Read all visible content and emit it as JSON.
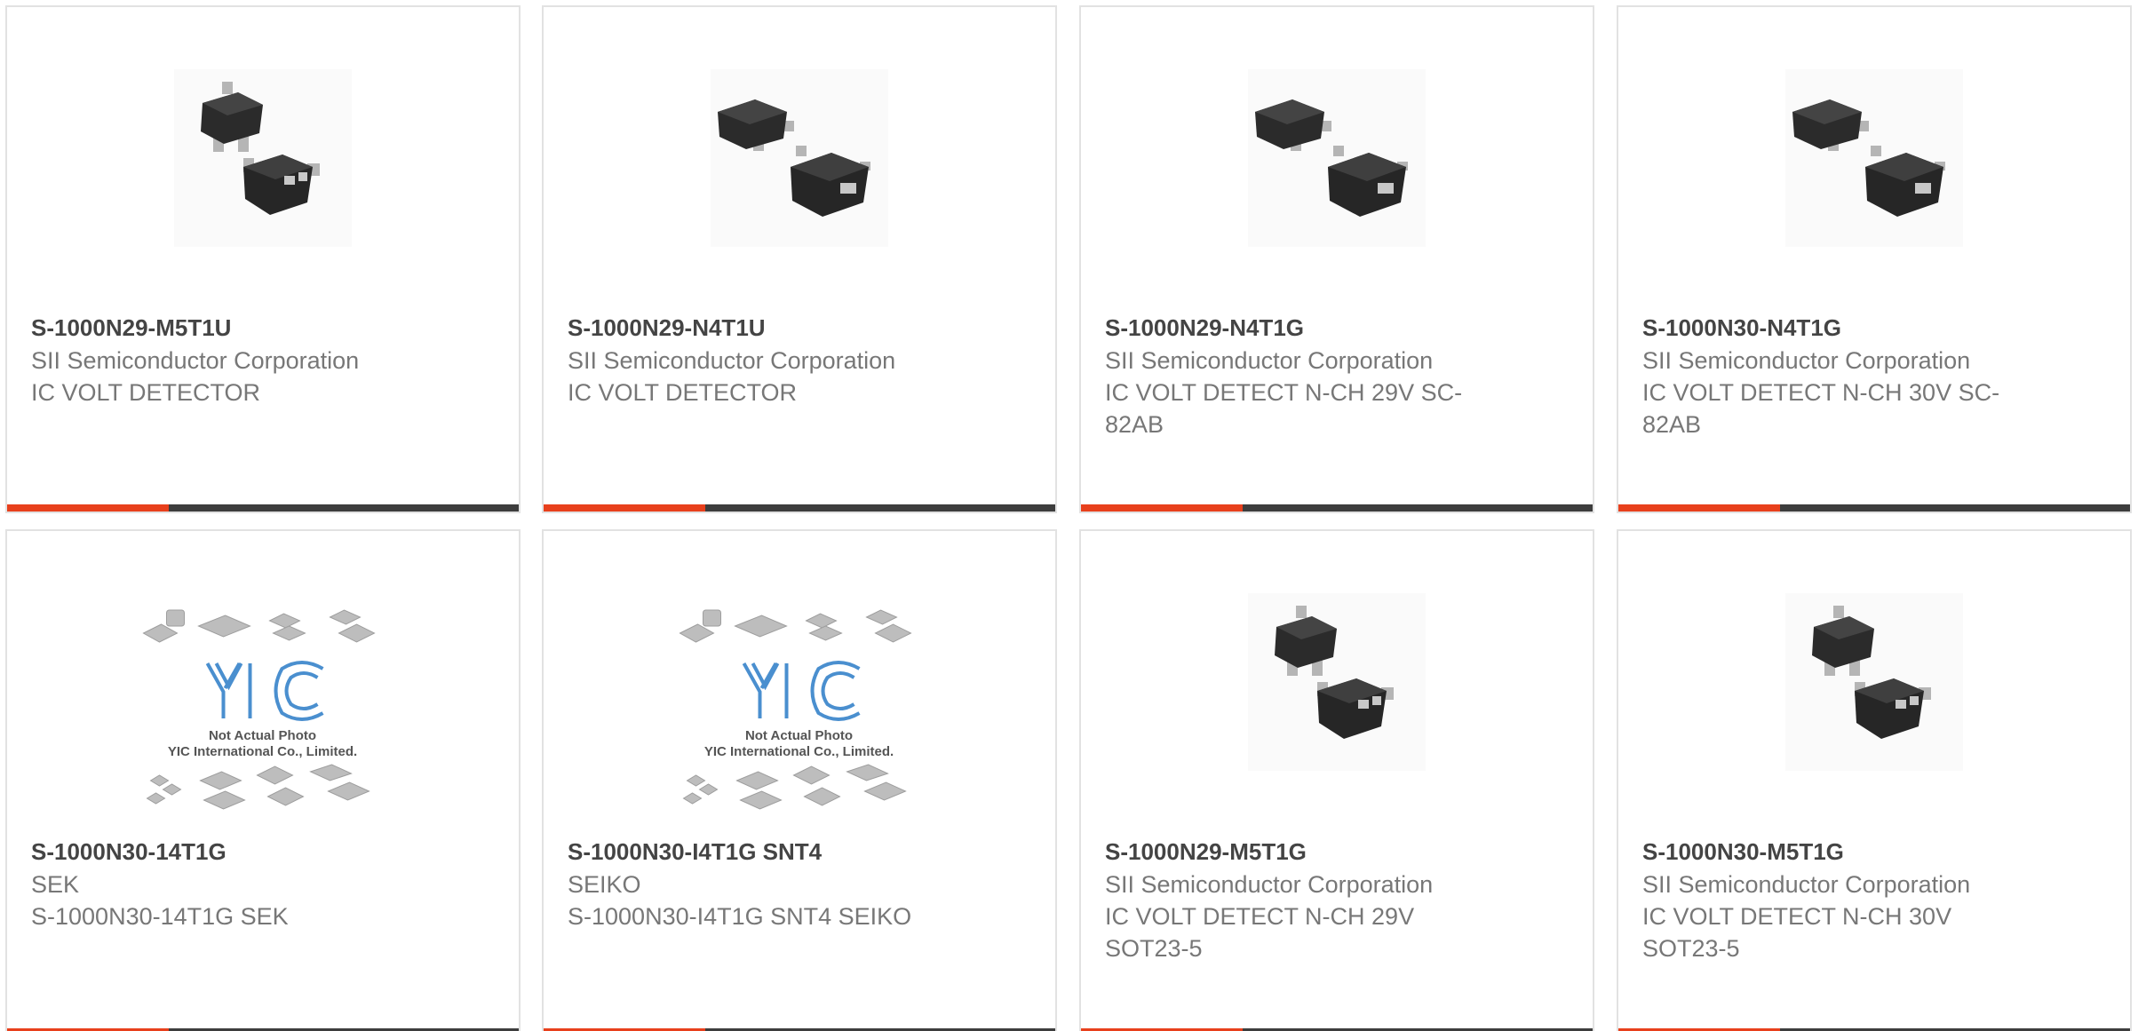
{
  "colors": {
    "accent": "#e8401c",
    "bar_dark": "#3d3d3d",
    "part_text": "#444444",
    "sub_text": "#777777"
  },
  "products": [
    {
      "part": "S-1000N29-M5T1U",
      "manufacturer": "SII Semiconductor Corporation",
      "description": "IC VOLT DETECTOR",
      "image": "sc82ab-chip-photo"
    },
    {
      "part": "S-1000N29-N4T1U",
      "manufacturer": "SII Semiconductor Corporation",
      "description": "IC VOLT DETECTOR",
      "image": "sc82ab-chip-photo"
    },
    {
      "part": "S-1000N29-N4T1G",
      "manufacturer": "SII Semiconductor Corporation",
      "description": "IC VOLT DETECT N-CH 29V SC-82AB",
      "image": "sc82ab-chip-photo"
    },
    {
      "part": "S-1000N30-N4T1G",
      "manufacturer": "SII Semiconductor Corporation",
      "description": "IC VOLT DETECT N-CH 30V SC-82AB",
      "image": "sc82ab-chip-photo"
    },
    {
      "part": "S-1000N30-14T1G",
      "manufacturer": "SEK",
      "description": "S-1000N30-14T1G SEK",
      "image": "yic-placeholder",
      "placeholder_line1": "Not Actual Photo",
      "placeholder_line2": "YIC International Co., Limited."
    },
    {
      "part": "S-1000N30-I4T1G SNT4",
      "manufacturer": "SEIKO",
      "description": "S-1000N30-I4T1G SNT4 SEIKO",
      "image": "yic-placeholder",
      "placeholder_line1": "Not Actual Photo",
      "placeholder_line2": "YIC International Co., Limited."
    },
    {
      "part": "S-1000N29-M5T1G",
      "manufacturer": "SII Semiconductor Corporation",
      "description": "IC VOLT DETECT N-CH 29V SOT23-5",
      "image": "sot23-chip-photo"
    },
    {
      "part": "S-1000N30-M5T1G",
      "manufacturer": "SII Semiconductor Corporation",
      "description": "IC VOLT DETECT N-CH 30V SOT23-5",
      "image": "sot23-chip-photo"
    }
  ]
}
